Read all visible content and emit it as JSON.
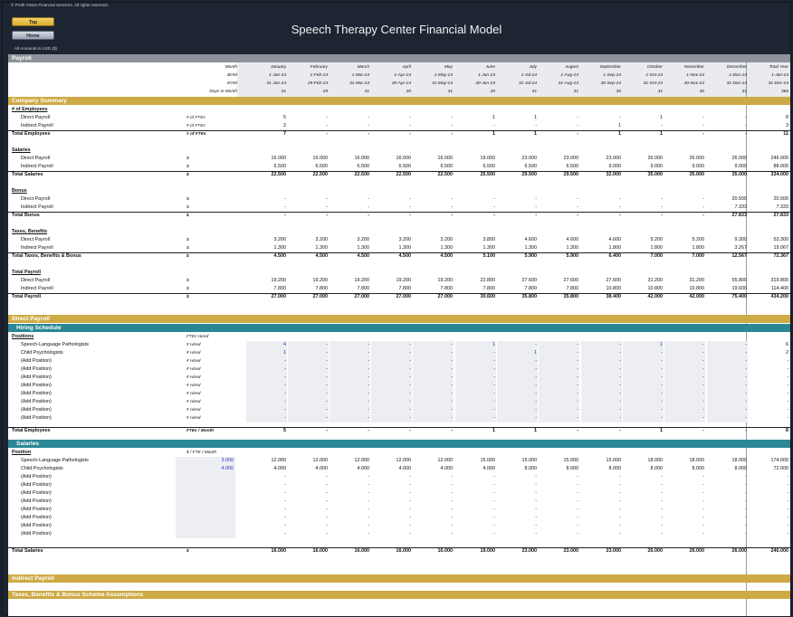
{
  "copyright": "© Profit Vision Financial Services. All rights reserved.",
  "nav": {
    "top": "Top",
    "home": "Home"
  },
  "title": "Speech Therapy Center Financial Model",
  "amounts_note": "All Amounts in  USD ($)",
  "sheet": {
    "payroll_header": "Payroll",
    "header_rows": [
      {
        "label": "Month",
        "values": [
          "January",
          "February",
          "March",
          "April",
          "May",
          "June",
          "July",
          "August",
          "September",
          "October",
          "November",
          "December",
          "Total Year"
        ]
      },
      {
        "label": "BOM",
        "values": [
          "1-Jan-24",
          "1-Feb-24",
          "1-Mar-24",
          "1-Apr-24",
          "1-May-24",
          "1-Jun-24",
          "1-Jul-24",
          "1-Aug-24",
          "1-Sep-24",
          "1-Oct-24",
          "1-Nov-24",
          "1-Dec-24",
          "1-Jan-24"
        ]
      },
      {
        "label": "EOM",
        "values": [
          "31-Jan-24",
          "29-Feb-24",
          "31-Mar-24",
          "30-Apr-24",
          "31-May-24",
          "30-Jun-24",
          "31-Jul-24",
          "31-Aug-24",
          "30-Sep-24",
          "31-Oct-24",
          "30-Nov-24",
          "31-Dec-24",
          "31-Dec-24"
        ]
      },
      {
        "label": "Days in Month",
        "values": [
          "31",
          "29",
          "31",
          "30",
          "31",
          "30",
          "31",
          "31",
          "30",
          "31",
          "30",
          "31",
          "366"
        ]
      }
    ],
    "company_summary_header": "Company Summary",
    "summary_rows": [
      {
        "kind": "u",
        "label": "# of Employees"
      },
      {
        "kind": "i",
        "label": "Direct Payroll",
        "unit": "# of FTEs",
        "values": [
          "5",
          "-",
          "-",
          "-",
          "-",
          "1",
          "1",
          "-",
          "-",
          "1",
          "-",
          "-",
          "8"
        ]
      },
      {
        "kind": "i",
        "label": "Indirect Payroll",
        "unit": "# of FTEs",
        "values": [
          "2",
          "-",
          "-",
          "-",
          "-",
          "-",
          "-",
          "-",
          "1",
          "-",
          "-",
          "-",
          "3"
        ]
      },
      {
        "kind": "t",
        "label": "Total Employees",
        "unit": "# of FTEs",
        "values": [
          "7",
          "-",
          "-",
          "-",
          "-",
          "1",
          "1",
          "-",
          "1",
          "1",
          "-",
          "-",
          "11"
        ]
      },
      {
        "kind": "gap"
      },
      {
        "kind": "u",
        "label": "Salaries"
      },
      {
        "kind": "i",
        "label": "Direct Payroll",
        "unit": "$",
        "values": [
          "16.000",
          "16.000",
          "16.000",
          "16.000",
          "16.000",
          "19.000",
          "23.000",
          "23.000",
          "23.000",
          "26.000",
          "26.000",
          "26.000",
          "246.000"
        ]
      },
      {
        "kind": "i",
        "label": "Indirect Payroll",
        "unit": "$",
        "values": [
          "6.500",
          "6.500",
          "6.500",
          "6.500",
          "6.500",
          "6.500",
          "6.500",
          "6.500",
          "9.000",
          "9.000",
          "9.000",
          "9.000",
          "88.000"
        ]
      },
      {
        "kind": "t",
        "label": "Total Salaries",
        "unit": "$",
        "values": [
          "22.500",
          "22.500",
          "22.500",
          "22.500",
          "22.500",
          "25.500",
          "29.500",
          "29.500",
          "32.000",
          "35.000",
          "35.000",
          "35.000",
          "334.000"
        ]
      },
      {
        "kind": "gap"
      },
      {
        "kind": "u",
        "label": "Bonus"
      },
      {
        "kind": "i",
        "label": "Direct Payroll",
        "unit": "$",
        "values": [
          "-",
          "-",
          "-",
          "-",
          "-",
          "-",
          "-",
          "-",
          "-",
          "-",
          "-",
          "20.500",
          "20.500"
        ]
      },
      {
        "kind": "i",
        "label": "Indirect Payroll",
        "unit": "$",
        "values": [
          "-",
          "-",
          "-",
          "-",
          "-",
          "-",
          "-",
          "-",
          "-",
          "-",
          "-",
          "7.333",
          "7.333"
        ]
      },
      {
        "kind": "t",
        "label": "Total Bonus",
        "unit": "$",
        "values": [
          "-",
          "-",
          "-",
          "-",
          "-",
          "-",
          "-",
          "-",
          "-",
          "-",
          "-",
          "27.833",
          "27.833"
        ]
      },
      {
        "kind": "gap"
      },
      {
        "kind": "u",
        "label": "Taxes, Benefits"
      },
      {
        "kind": "i",
        "label": "Direct Payroll",
        "unit": "$",
        "values": [
          "3.200",
          "3.200",
          "3.200",
          "3.200",
          "3.200",
          "3.800",
          "4.600",
          "4.600",
          "4.600",
          "5.200",
          "5.200",
          "9.300",
          "53.300"
        ]
      },
      {
        "kind": "i",
        "label": "Indirect Payroll",
        "unit": "$",
        "values": [
          "1.300",
          "1.300",
          "1.300",
          "1.300",
          "1.300",
          "1.300",
          "1.300",
          "1.300",
          "1.800",
          "1.800",
          "1.800",
          "3.267",
          "19.067"
        ]
      },
      {
        "kind": "t",
        "label": "Total Taxes, Benefits & Bonus",
        "unit": "$",
        "values": [
          "4.500",
          "4.500",
          "4.500",
          "4.500",
          "4.500",
          "5.100",
          "5.900",
          "5.900",
          "6.400",
          "7.000",
          "7.000",
          "12.567",
          "72.367"
        ]
      },
      {
        "kind": "gap"
      },
      {
        "kind": "u",
        "label": "Total Payroll"
      },
      {
        "kind": "i",
        "label": "Direct Payroll",
        "unit": "$",
        "values": [
          "19.200",
          "19.200",
          "19.200",
          "19.200",
          "19.200",
          "22.800",
          "27.600",
          "27.600",
          "27.600",
          "31.200",
          "31.200",
          "55.800",
          "319.800"
        ]
      },
      {
        "kind": "i",
        "label": "Indirect Payroll",
        "unit": "$",
        "values": [
          "7.800",
          "7.800",
          "7.800",
          "7.800",
          "7.800",
          "7.800",
          "7.800",
          "7.800",
          "10.800",
          "10.800",
          "10.800",
          "19.600",
          "114.400"
        ]
      },
      {
        "kind": "t",
        "label": "Total Payroll",
        "unit": "$",
        "values": [
          "27.000",
          "27.000",
          "27.000",
          "27.000",
          "27.000",
          "30.600",
          "35.800",
          "35.800",
          "38.400",
          "42.000",
          "42.000",
          "75.400",
          "434.200"
        ]
      }
    ],
    "direct_payroll_header": "Direct Payroll",
    "hiring_schedule_header": "Hiring Schedule",
    "hiring_title": {
      "label": "Positions",
      "unit": "FTEs Hired"
    },
    "hiring_rows": [
      {
        "label": "Speech-Language Pathologists",
        "unit": "# Hired",
        "values": [
          "4",
          "-",
          "-",
          "-",
          "-",
          "1",
          "-",
          "-",
          "-",
          "1",
          "-",
          "-",
          "6"
        ]
      },
      {
        "label": "Child Psychologists",
        "unit": "# Hired",
        "values": [
          "1",
          "-",
          "-",
          "-",
          "-",
          "-",
          "1",
          "-",
          "-",
          "-",
          "-",
          "-",
          "2"
        ]
      },
      {
        "label": "(Add Position)",
        "unit": "# Hired",
        "values": [
          "-",
          "-",
          "-",
          "-",
          "-",
          "-",
          "-",
          "-",
          "-",
          "-",
          "-",
          "-",
          "-"
        ]
      },
      {
        "label": "(Add Position)",
        "unit": "# Hired",
        "values": [
          "-",
          "-",
          "-",
          "-",
          "-",
          "-",
          "-",
          "-",
          "-",
          "-",
          "-",
          "-",
          "-"
        ]
      },
      {
        "label": "(Add Position)",
        "unit": "# Hired",
        "values": [
          "-",
          "-",
          "-",
          "-",
          "-",
          "-",
          "-",
          "-",
          "-",
          "-",
          "-",
          "-",
          "-"
        ]
      },
      {
        "label": "(Add Position)",
        "unit": "# Hired",
        "values": [
          "-",
          "-",
          "-",
          "-",
          "-",
          "-",
          "-",
          "-",
          "-",
          "-",
          "-",
          "-",
          "-"
        ]
      },
      {
        "label": "(Add Position)",
        "unit": "# Hired",
        "values": [
          "-",
          "-",
          "-",
          "-",
          "-",
          "-",
          "-",
          "-",
          "-",
          "-",
          "-",
          "-",
          "-"
        ]
      },
      {
        "label": "(Add Position)",
        "unit": "# Hired",
        "values": [
          "-",
          "-",
          "-",
          "-",
          "-",
          "-",
          "-",
          "-",
          "-",
          "-",
          "-",
          "-",
          "-"
        ]
      },
      {
        "label": "(Add Position)",
        "unit": "# Hired",
        "values": [
          "-",
          "-",
          "-",
          "-",
          "-",
          "-",
          "-",
          "-",
          "-",
          "-",
          "-",
          "-",
          "-"
        ]
      },
      {
        "label": "(Add Position)",
        "unit": "# Hired",
        "values": [
          "-",
          "-",
          "-",
          "-",
          "-",
          "-",
          "-",
          "-",
          "-",
          "-",
          "-",
          "-",
          "-"
        ]
      }
    ],
    "hiring_total": {
      "label": "Total Employees",
      "unit": "FTEs / Month",
      "values": [
        "5",
        "-",
        "-",
        "-",
        "-",
        "1",
        "1",
        "-",
        "-",
        "1",
        "-",
        "-",
        "8"
      ]
    },
    "salaries_header": "Salaries",
    "salaries_title": {
      "label": "Position",
      "unit": "$ / FTE / Month"
    },
    "salary_rows": [
      {
        "label": "Speech-Language Pathologists",
        "input": "3.000",
        "values": [
          "12.000",
          "12.000",
          "12.000",
          "12.000",
          "12.000",
          "15.000",
          "15.000",
          "15.000",
          "15.000",
          "18.000",
          "18.000",
          "18.000",
          "174.000"
        ]
      },
      {
        "label": "Child Psychologists",
        "input": "4.000",
        "values": [
          "4.000",
          "4.000",
          "4.000",
          "4.000",
          "4.000",
          "4.000",
          "8.000",
          "8.000",
          "8.000",
          "8.000",
          "8.000",
          "8.000",
          "72.000"
        ]
      },
      {
        "label": "(Add Position)",
        "input": "",
        "values": [
          "-",
          "-",
          "-",
          "-",
          "-",
          "-",
          "-",
          "-",
          "-",
          "-",
          "-",
          "-",
          "-"
        ]
      },
      {
        "label": "(Add Position)",
        "input": "",
        "values": [
          "-",
          "-",
          "-",
          "-",
          "-",
          "-",
          "-",
          "-",
          "-",
          "-",
          "-",
          "-",
          "-"
        ]
      },
      {
        "label": "(Add Position)",
        "input": "",
        "values": [
          "-",
          "-",
          "-",
          "-",
          "-",
          "-",
          "-",
          "-",
          "-",
          "-",
          "-",
          "-",
          "-"
        ]
      },
      {
        "label": "(Add Position)",
        "input": "",
        "values": [
          "-",
          "-",
          "-",
          "-",
          "-",
          "-",
          "-",
          "-",
          "-",
          "-",
          "-",
          "-",
          "-"
        ]
      },
      {
        "label": "(Add Position)",
        "input": "",
        "values": [
          "-",
          "-",
          "-",
          "-",
          "-",
          "-",
          "-",
          "-",
          "-",
          "-",
          "-",
          "-",
          "-"
        ]
      },
      {
        "label": "(Add Position)",
        "input": "",
        "values": [
          "-",
          "-",
          "-",
          "-",
          "-",
          "-",
          "-",
          "-",
          "-",
          "-",
          "-",
          "-",
          "-"
        ]
      },
      {
        "label": "(Add Position)",
        "input": "",
        "values": [
          "-",
          "-",
          "-",
          "-",
          "-",
          "-",
          "-",
          "-",
          "-",
          "-",
          "-",
          "-",
          "-"
        ]
      },
      {
        "label": "(Add Position)",
        "input": "",
        "values": [
          "-",
          "-",
          "-",
          "-",
          "-",
          "-",
          "-",
          "-",
          "-",
          "-",
          "-",
          "-",
          "-"
        ]
      }
    ],
    "salaries_total": {
      "label": "Total Salaries",
      "unit": "$",
      "values": [
        "16.000",
        "16.000",
        "16.000",
        "16.000",
        "16.000",
        "19.000",
        "23.000",
        "23.000",
        "23.000",
        "26.000",
        "26.000",
        "26.000",
        "246.000"
      ]
    },
    "indirect_payroll_header": "Indirect Payroll",
    "taxes_header": "Taxes, Benefits & Bonus Scheme Assumptions"
  },
  "colors": {
    "gold": "#cdaa45",
    "teal": "#2b8794",
    "gray": "#8e939b",
    "input_blue": "#2f2fc0"
  }
}
